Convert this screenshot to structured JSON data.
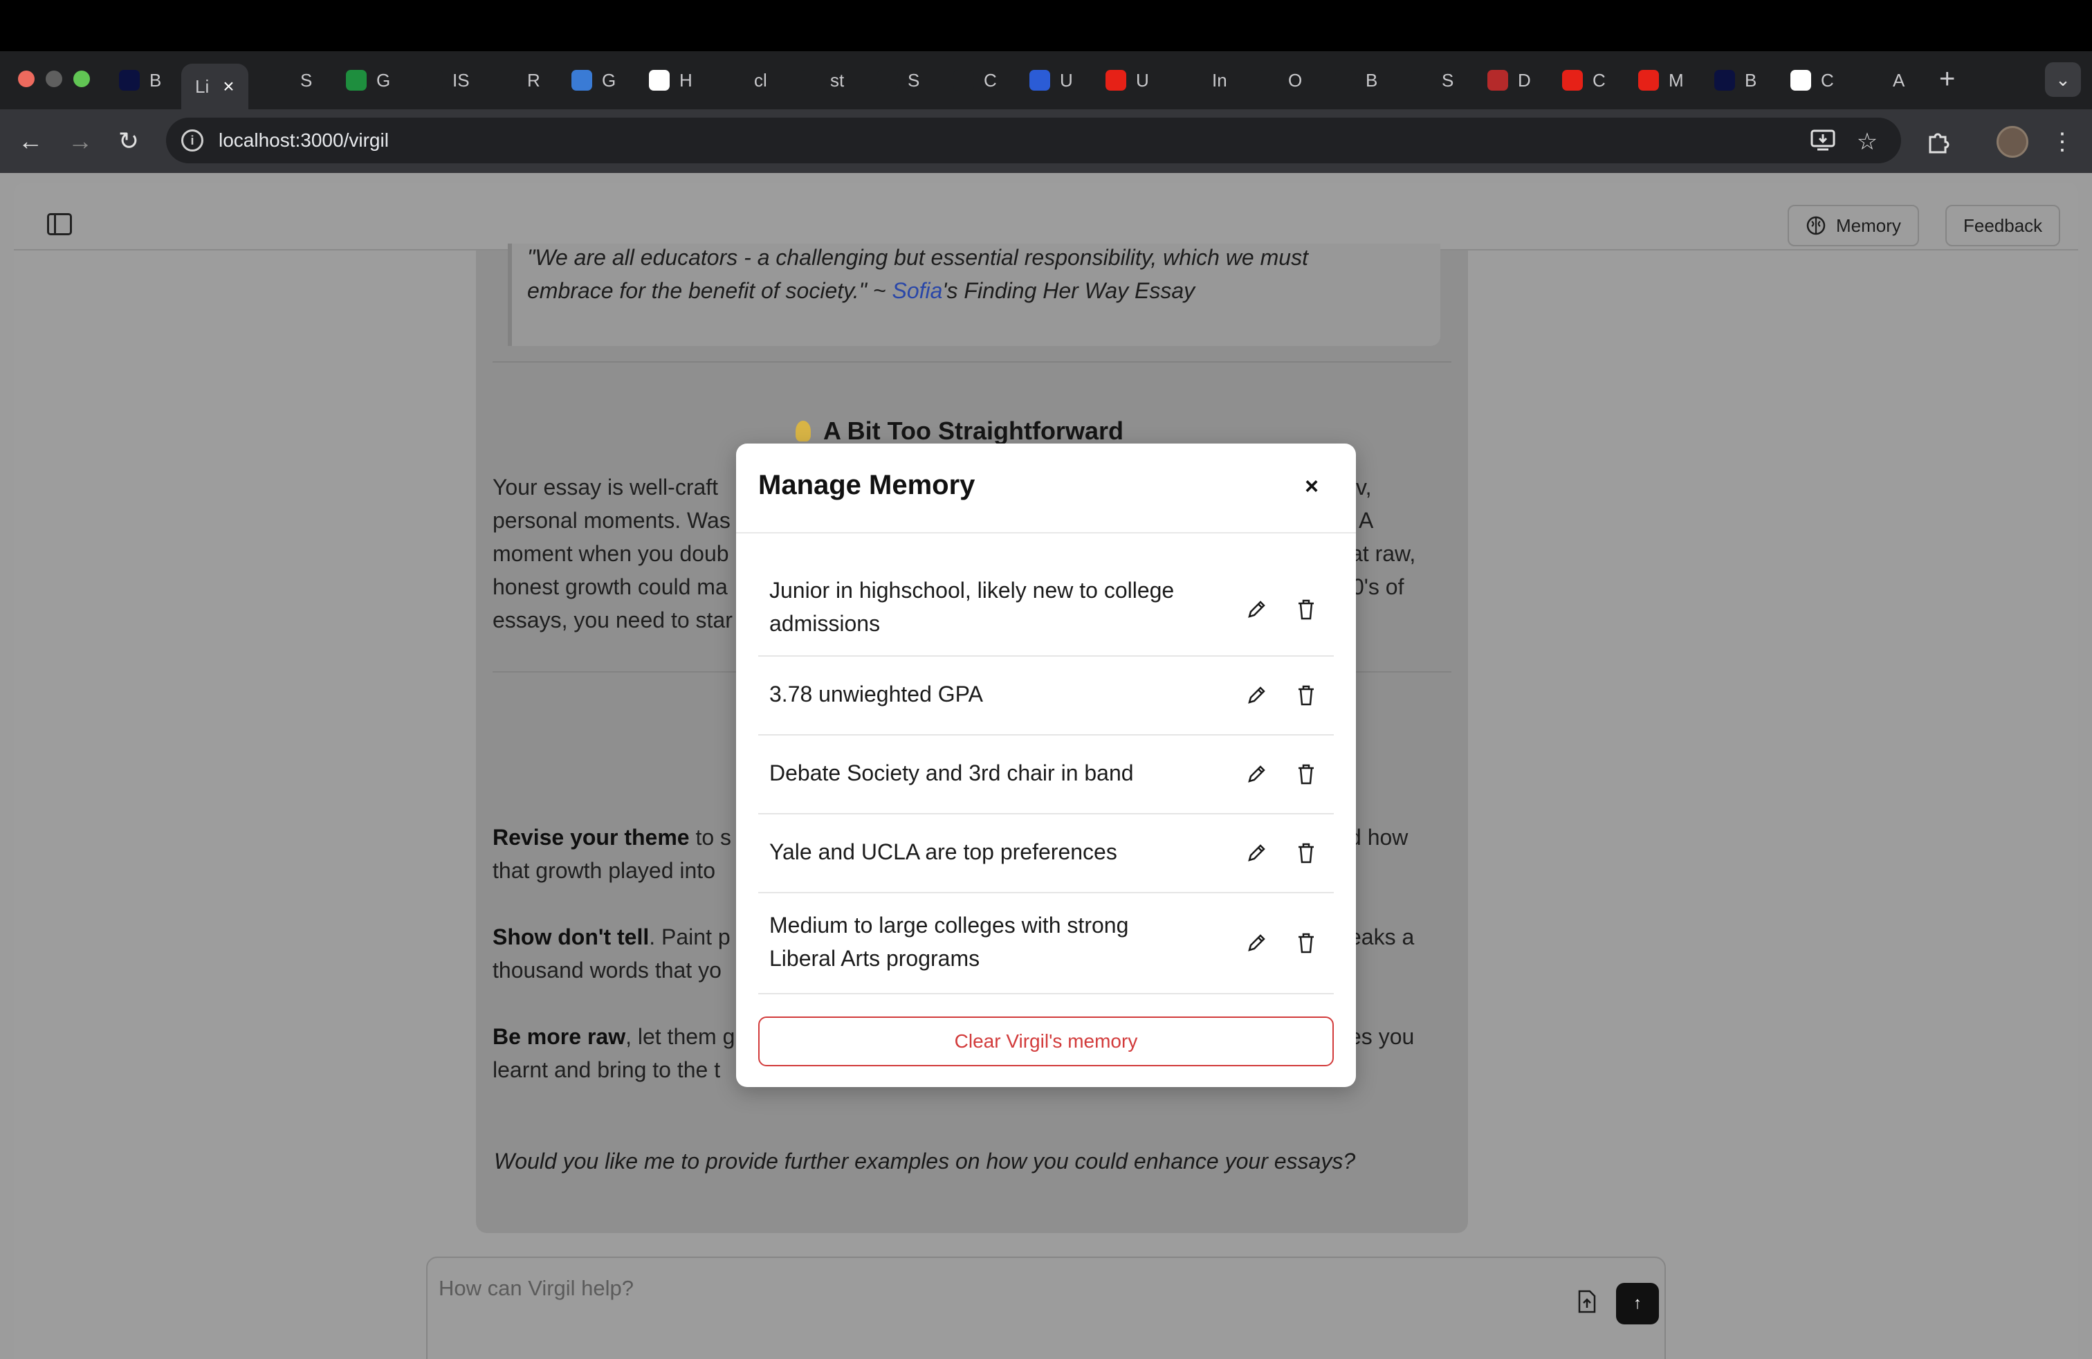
{
  "colors": {
    "traffic_red": "#ed6a5e",
    "traffic_yellow": "#5f5f5f",
    "traffic_green": "#61c554",
    "accent_red": "#d23b3b",
    "link_blue": "#2a47a8"
  },
  "browser": {
    "tabs": [
      {
        "label": "B",
        "icon": "tab-favicon",
        "color": "#0b1140"
      },
      {
        "label": "Li",
        "icon": "tab-favicon",
        "color": "#555555"
      },
      {
        "label": "S",
        "icon": "asterisk-icon",
        "color": "#1f2022"
      },
      {
        "label": "G",
        "icon": "meet-icon",
        "color": "#1e8e3e"
      },
      {
        "label": "IS",
        "icon": "google-icon",
        "color": "#1f2022"
      },
      {
        "label": "R",
        "icon": "sparkle-icon",
        "color": "#1f2022"
      },
      {
        "label": "G",
        "icon": "globe-icon",
        "color": "#3a7bd5"
      },
      {
        "label": "H",
        "icon": "wikipedia-icon",
        "color": "#ffffff"
      },
      {
        "label": "cl",
        "icon": "google-icon",
        "color": "#1f2022"
      },
      {
        "label": "st",
        "icon": "google-icon",
        "color": "#1f2022"
      },
      {
        "label": "S",
        "icon": "bug-icon",
        "color": "#1f2022"
      },
      {
        "label": "C",
        "icon": "google-icon",
        "color": "#1f2022"
      },
      {
        "label": "U",
        "icon": "word-icon",
        "color": "#2b5cd6"
      },
      {
        "label": "U",
        "icon": "youtube-icon",
        "color": "#e62117"
      },
      {
        "label": "In",
        "icon": "tailwind-icon",
        "color": "#1f2022"
      },
      {
        "label": "O",
        "icon": "google-icon",
        "color": "#1f2022"
      },
      {
        "label": "B",
        "icon": "eye-icon",
        "color": "#1f2022"
      },
      {
        "label": "S",
        "icon": "spinner-icon",
        "color": "#1f2022"
      },
      {
        "label": "D",
        "icon": "dots-icon",
        "color": "#b52a2a"
      },
      {
        "label": "C",
        "icon": "youtube-icon",
        "color": "#e62117"
      },
      {
        "label": "M",
        "icon": "youtube-icon",
        "color": "#e62117"
      },
      {
        "label": "B",
        "icon": "tab-favicon",
        "color": "#0b1140"
      },
      {
        "label": "C",
        "icon": "h-icon",
        "color": "#ffffff"
      },
      {
        "label": "A",
        "icon": "phone-icon",
        "color": "#1f2022"
      }
    ],
    "url": "localhost:3000/virgil"
  },
  "app": {
    "memory_button": "Memory",
    "feedback_button": "Feedback"
  },
  "chat": {
    "quote_line1": "\"We are all educators - a challenging but essential responsibility, which we must",
    "quote_line2_pre": "embrace for the benefit of society.\" ~ ",
    "quote_link": "Sofia",
    "quote_line2_post": "'s Finding Her Way Essay",
    "heading": "A Bit Too Straightforward",
    "para1": [
      "Your essay is well-craft",
      "personal moments. Was",
      "moment when you doub",
      "honest growth could ma",
      "essays, you need to star"
    ],
    "para1_right": [
      "v,",
      "A",
      "at raw,",
      "0's of"
    ],
    "revise_bold": "Revise your theme",
    "revise_rest": " to s",
    "revise_line2": "that growth played into",
    "revise_right": "d how",
    "show_bold": "Show don't tell",
    "show_rest": ". Paint p",
    "show_line2": "thousand words that yo",
    "show_right": "eaks a",
    "raw_bold": "Be more raw",
    "raw_rest": ", let them g",
    "raw_line2": "learnt and bring to the t",
    "raw_right": "es you",
    "closing": "Would you like me to provide further examples on how you could enhance your essays?"
  },
  "composer": {
    "placeholder": "How can Virgil help?"
  },
  "modal": {
    "title": "Manage Memory",
    "items": [
      {
        "line1": "Junior in highschool, likely new to college",
        "line2": "admissions"
      },
      {
        "line1": "3.78 unwieghted GPA",
        "line2": ""
      },
      {
        "line1": "Debate Society and 3rd chair in band",
        "line2": ""
      },
      {
        "line1": "Yale and UCLA are top preferences",
        "line2": ""
      },
      {
        "line1": "Medium to large colleges with strong",
        "line2": "Liberal Arts programs"
      }
    ],
    "clear_button": "Clear Virgil's memory"
  }
}
